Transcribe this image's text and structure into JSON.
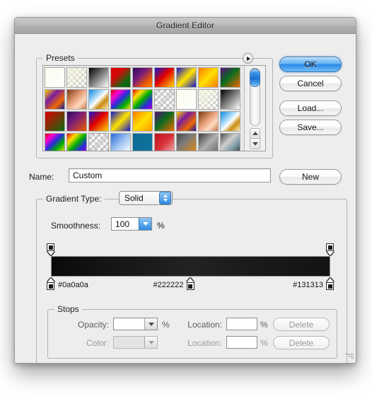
{
  "window": {
    "title": "Gradient Editor"
  },
  "presets": {
    "title": "Presets",
    "menu_icon": "triangle-right-icon",
    "scrollbar": {
      "up_icon": "arrow-up-icon",
      "down_icon": "arrow-down-icon"
    },
    "swatches": [
      {
        "name": "foreground-to-background",
        "css": "linear-gradient(135deg,#fbfbee 0%,#ffffff 100%)",
        "checker": false
      },
      {
        "name": "foreground-to-transparent",
        "css": "linear-gradient(135deg,#f2f1dc 0%,rgba(255,255,255,0) 100%)",
        "checker": true
      },
      {
        "name": "black-white",
        "css": "linear-gradient(135deg,#000000 0%,#ffffff 100%)",
        "checker": false
      },
      {
        "name": "red-green",
        "css": "linear-gradient(135deg,#e00000 0%,#d10a0a 35%,#0d6b12 75%,#0a5d10 100%)",
        "checker": false
      },
      {
        "name": "violet-orange",
        "css": "linear-gradient(135deg,#2d0a5e 0%,#7a1d7a 40%,#ef5a00 75%,#ff7a00 100%)",
        "checker": false
      },
      {
        "name": "blue-red-yellow",
        "css": "linear-gradient(135deg,#1414cf 0%,#e00000 45%,#ffd400 100%)",
        "checker": false
      },
      {
        "name": "blue-yellow-blue",
        "css": "linear-gradient(135deg,#1414cf 0%,#ffe400 50%,#1414cf 100%)",
        "checker": false
      },
      {
        "name": "orange-yellow-orange",
        "css": "linear-gradient(135deg,#ff7a00 0%,#ffe000 50%,#ff7a00 100%)",
        "checker": false
      },
      {
        "name": "violet-green-orange",
        "css": "linear-gradient(135deg,#5a0f7a 0%,#0a6b1e 45%,#ef6a00 100%)",
        "checker": false
      },
      {
        "name": "yellow-violet-orange-blue",
        "css": "linear-gradient(135deg,#ffd400 0%,#7a1d9e 35%,#ef6a00 70%,#1414a0 100%)",
        "checker": false
      },
      {
        "name": "copper",
        "css": "linear-gradient(135deg,#7a3a10 0%,#e8a07a 45%,#ffd9c0 70%,#c07a4a 100%)",
        "checker": false
      },
      {
        "name": "chrome",
        "css": "linear-gradient(135deg,#0a8ae0 0%,#bfe4fb 40%,#ffffff 50%,#c98a10 70%,#ffe9b0 100%)",
        "checker": false
      },
      {
        "name": "spectrum",
        "css": "linear-gradient(135deg,#e00000 0%,#ff00d0 25%,#2a2ae0 50%,#00b000 75%,#ffe000 100%)",
        "checker": false
      },
      {
        "name": "transparent-rainbow",
        "css": "linear-gradient(135deg,#e00000 0%,#ffe000 25%,#00b000 50%,#2a2ae0 75%,#b000d0 100%)",
        "checker": true
      },
      {
        "name": "transparent-stripes",
        "css": "repeating-linear-gradient(135deg,rgba(200,200,200,.55) 0px,rgba(200,200,200,.55) 4px,rgba(255,255,255,0) 4px,rgba(255,255,255,0) 9px)",
        "checker": true
      },
      {
        "name": "foreground-solid",
        "css": "linear-gradient(135deg,#fbfbee 0%,#ffffff 100%)",
        "checker": false
      },
      {
        "name": "background-to-transparent",
        "css": "linear-gradient(135deg,#f4f3e2 0%,rgba(255,255,255,0) 100%)",
        "checker": true
      },
      {
        "name": "black-to-white-2",
        "css": "linear-gradient(135deg,#000000 0%,#ffffff 100%)",
        "checker": false
      },
      {
        "name": "red-green-2",
        "css": "linear-gradient(135deg,#e00000 0%,#0d6b12 100%)",
        "checker": false
      },
      {
        "name": "violet-orange-2",
        "css": "linear-gradient(135deg,#2d0a5e 0%,#7a1d7a 40%,#ef5a00 100%)",
        "checker": false
      },
      {
        "name": "blue-red-yellow-2",
        "css": "linear-gradient(135deg,#1414cf 0%,#e00000 45%,#ffd400 100%)",
        "checker": false
      },
      {
        "name": "blue-yellow-blue-2",
        "css": "linear-gradient(135deg,#1414cf 0%,#ffe400 50%,#1414cf 100%)",
        "checker": false
      },
      {
        "name": "orange-yellow-orange-2",
        "css": "linear-gradient(135deg,#ff7a00 0%,#ffe000 50%,#ff9a00 100%)",
        "checker": false
      },
      {
        "name": "violet-green-orange-2",
        "css": "linear-gradient(135deg,#5a0f7a 0%,#0a6b1e 45%,#ef6a00 100%)",
        "checker": false
      },
      {
        "name": "yellow-violet-orange-blue-2",
        "css": "linear-gradient(135deg,#ffd400 0%,#7a1d9e 35%,#ef6a00 70%,#1414a0 100%)",
        "checker": false
      },
      {
        "name": "copper-2",
        "css": "linear-gradient(135deg,#7a3a10 0%,#e8a07a 45%,#ffd9c0 70%,#c07a4a 100%)",
        "checker": false
      },
      {
        "name": "chrome-2",
        "css": "linear-gradient(135deg,#0a8ae0 0%,#bfe4fb 42%,#ffffff 52%,#c98a10 72%,#fff0c0 100%)",
        "checker": false
      },
      {
        "name": "spectrum-2",
        "css": "linear-gradient(135deg,#e00000 0%,#ff00d0 22%,#2a2ae0 45%,#00b000 70%,#ffe000 100%)",
        "checker": false
      },
      {
        "name": "transparent-rainbow-2",
        "css": "linear-gradient(135deg,#e00000 0%,#ffe000 25%,#00b000 50%,#2a2ae0 75%,#b000d0 100%)",
        "checker": true
      },
      {
        "name": "transparent-stripes-2",
        "css": "repeating-linear-gradient(135deg,rgba(190,190,190,.5) 0px,rgba(190,190,190,.5) 4px,rgba(255,255,255,0) 4px,rgba(255,255,255,0) 9px)",
        "checker": true
      },
      {
        "name": "blue-white",
        "css": "linear-gradient(135deg,#2a6ad8 0%,#9ec4f0 50%,#ffffff 100%)",
        "checker": false
      },
      {
        "name": "teal-solid",
        "css": "linear-gradient(135deg,#0a6a92 0%,#1276a0 100%)",
        "checker": false
      },
      {
        "name": "red-dark",
        "css": "linear-gradient(135deg,#c01018 0%,#d8323a 50%,#f0b0b0 100%)",
        "checker": false
      },
      {
        "name": "gray-orange",
        "css": "linear-gradient(135deg,#4a4a4a 0%,#7a7a7a 40%,#e08a10 100%)",
        "checker": false
      },
      {
        "name": "steel",
        "css": "linear-gradient(135deg,#3a3a3a 0%,#b0b0b0 50%,#6a6a6a 100%)",
        "checker": false
      },
      {
        "name": "silver-teal",
        "css": "linear-gradient(135deg,#4a4a4a 0%,#cfcfcf 40%,#7a9aa4 70%,#3a3a3a 100%)",
        "checker": false
      }
    ]
  },
  "buttons": {
    "ok": "OK",
    "cancel": "Cancel",
    "load": "Load...",
    "save": "Save...",
    "new": "New"
  },
  "name_row": {
    "label": "Name:",
    "value": "Custom"
  },
  "gradient_type": {
    "label": "Gradient Type:",
    "value": "Solid",
    "stepper_icon": "stepper-updown-icon"
  },
  "smoothness": {
    "label": "Smoothness:",
    "value": "100",
    "unit": "%",
    "dropdown_icon": "chevron-down-icon"
  },
  "gradient_bar": {
    "css": "linear-gradient(to right,#0a0a0a 0%,#141414 18%,#222222 50%,#1a1a1a 72%,#131313 100%)",
    "opacity_stops": [
      {
        "name": "opacity-stop-left",
        "position_pct": 0
      },
      {
        "name": "opacity-stop-right",
        "position_pct": 100
      }
    ],
    "color_stops": [
      {
        "name": "color-stop-1",
        "position_pct": 0,
        "hex": "#0a0a0a",
        "label_side": "right"
      },
      {
        "name": "color-stop-2",
        "position_pct": 50,
        "hex": "#222222",
        "label_side": "left"
      },
      {
        "name": "color-stop-3",
        "position_pct": 100,
        "hex": "#131313",
        "label_side": "left"
      }
    ]
  },
  "stops": {
    "title": "Stops",
    "opacity_label": "Opacity:",
    "opacity_value": "",
    "opacity_unit": "%",
    "opacity_location_label": "Location:",
    "opacity_location_value": "",
    "opacity_location_unit": "%",
    "opacity_delete": "Delete",
    "color_label": "Color:",
    "color_value": "",
    "color_location_label": "Location:",
    "color_location_value": "",
    "color_location_unit": "%",
    "color_delete": "Delete"
  },
  "resize_grip": "resize-grip-icon"
}
